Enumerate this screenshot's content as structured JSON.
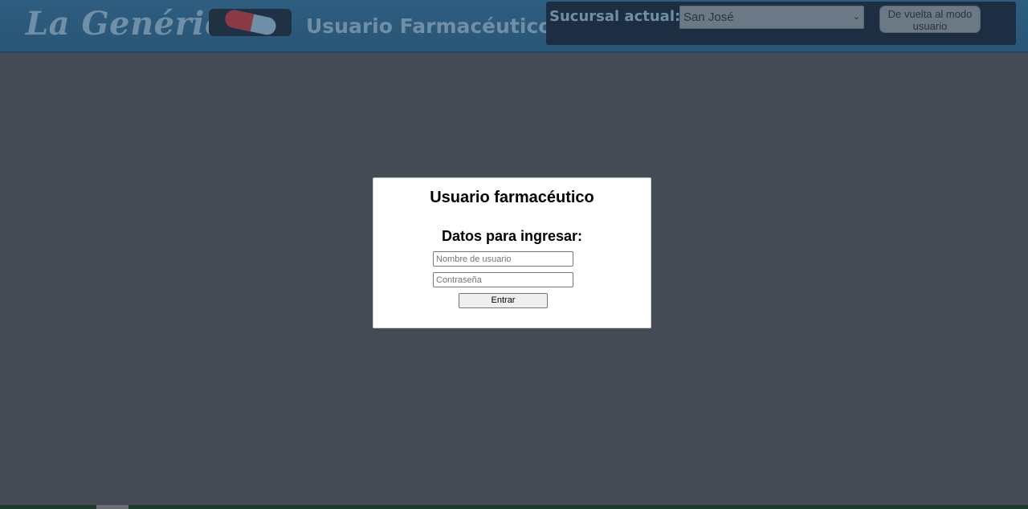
{
  "header": {
    "brand": "La Genérica",
    "pill_icon": "pill-icon",
    "subtitle": "Usuario Farmacéutico",
    "branch_label": "Sucursal actual:",
    "branch_selected": "San José",
    "back_button_label": "De vuelta al modo usuario"
  },
  "modal": {
    "title": "Usuario farmacéutico",
    "subtitle": "Datos para ingresar:",
    "username_placeholder": "Nombre de usuario",
    "password_placeholder": "Contraseña",
    "submit_label": "Entrar"
  },
  "colors": {
    "header_bg": "#2e5d80",
    "overlay_bg": "#454b55",
    "modal_bg": "#ffffff",
    "pill_red": "#8a3a44",
    "pill_white": "#6f8fa7"
  }
}
